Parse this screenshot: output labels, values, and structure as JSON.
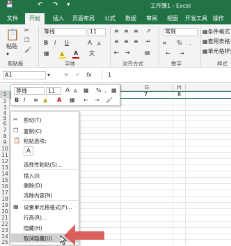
{
  "title_bar": {
    "title": "工作簿1 - Excel",
    "save_icon": "save-icon",
    "undo_icon": "undo-icon",
    "redo_icon": "redo-icon"
  },
  "tabs": [
    "文件",
    "开始",
    "插入",
    "页面布局",
    "公式",
    "数据",
    "审阅",
    "视图",
    "开发工具",
    "操作"
  ],
  "active_tab": "开始",
  "ribbon": {
    "font_name": "等线",
    "font_size": "11",
    "bold": "B",
    "italic": "I",
    "underline": "U",
    "grow_font": "A",
    "shrink_font": "A",
    "number_format": "常规",
    "paste_label": "粘贴",
    "groups": [
      "剪贴板",
      "字体",
      "对齐方式",
      "数字",
      "样式"
    ],
    "styles": [
      "条件格式",
      "套用表格",
      "单元格样式"
    ]
  },
  "formula_bar": {
    "name_box": "A1",
    "fx": "fx",
    "value": "1"
  },
  "columns": [
    "G",
    "H"
  ],
  "rows": [
    "1",
    "2",
    "3",
    "4",
    "5",
    "6",
    "7",
    "8",
    "9",
    "10",
    "11",
    "12",
    "13",
    "14",
    "15",
    "16",
    "17",
    "18",
    "19",
    "20",
    "21",
    "22",
    "23",
    "24",
    "25"
  ],
  "cells": {
    "G1": "7",
    "H1": "8"
  },
  "mini_toolbar": {
    "font_name": "等线",
    "font_size": "11",
    "bold": "B",
    "italic": "I",
    "percent": "%",
    "comma": ","
  },
  "context_menu": {
    "items": [
      {
        "label": "剪切(T)",
        "icon": "scissors-icon"
      },
      {
        "label": "复制(C)",
        "icon": "copy-icon"
      },
      {
        "label": "粘贴选项:",
        "icon": "paste-icon"
      },
      {
        "label": "A",
        "icon": "paste-option-icon"
      },
      {
        "label": "选择性粘贴(S)...",
        "icon": ""
      },
      {
        "label": "插入(I)",
        "icon": ""
      },
      {
        "label": "删除(D)",
        "icon": ""
      },
      {
        "label": "清除内容(N)",
        "icon": ""
      },
      {
        "label": "设置单元格格式(F)...",
        "icon": "format-cells-icon"
      },
      {
        "label": "行高(R)...",
        "icon": ""
      },
      {
        "label": "隐藏(H)",
        "icon": ""
      },
      {
        "label": "取消隐藏(U)",
        "icon": ""
      }
    ]
  },
  "colors": {
    "excel_green": "#217346",
    "arrow": "#d9534f",
    "font_red": "#c00000",
    "fill_yellow": "#ffd700"
  }
}
